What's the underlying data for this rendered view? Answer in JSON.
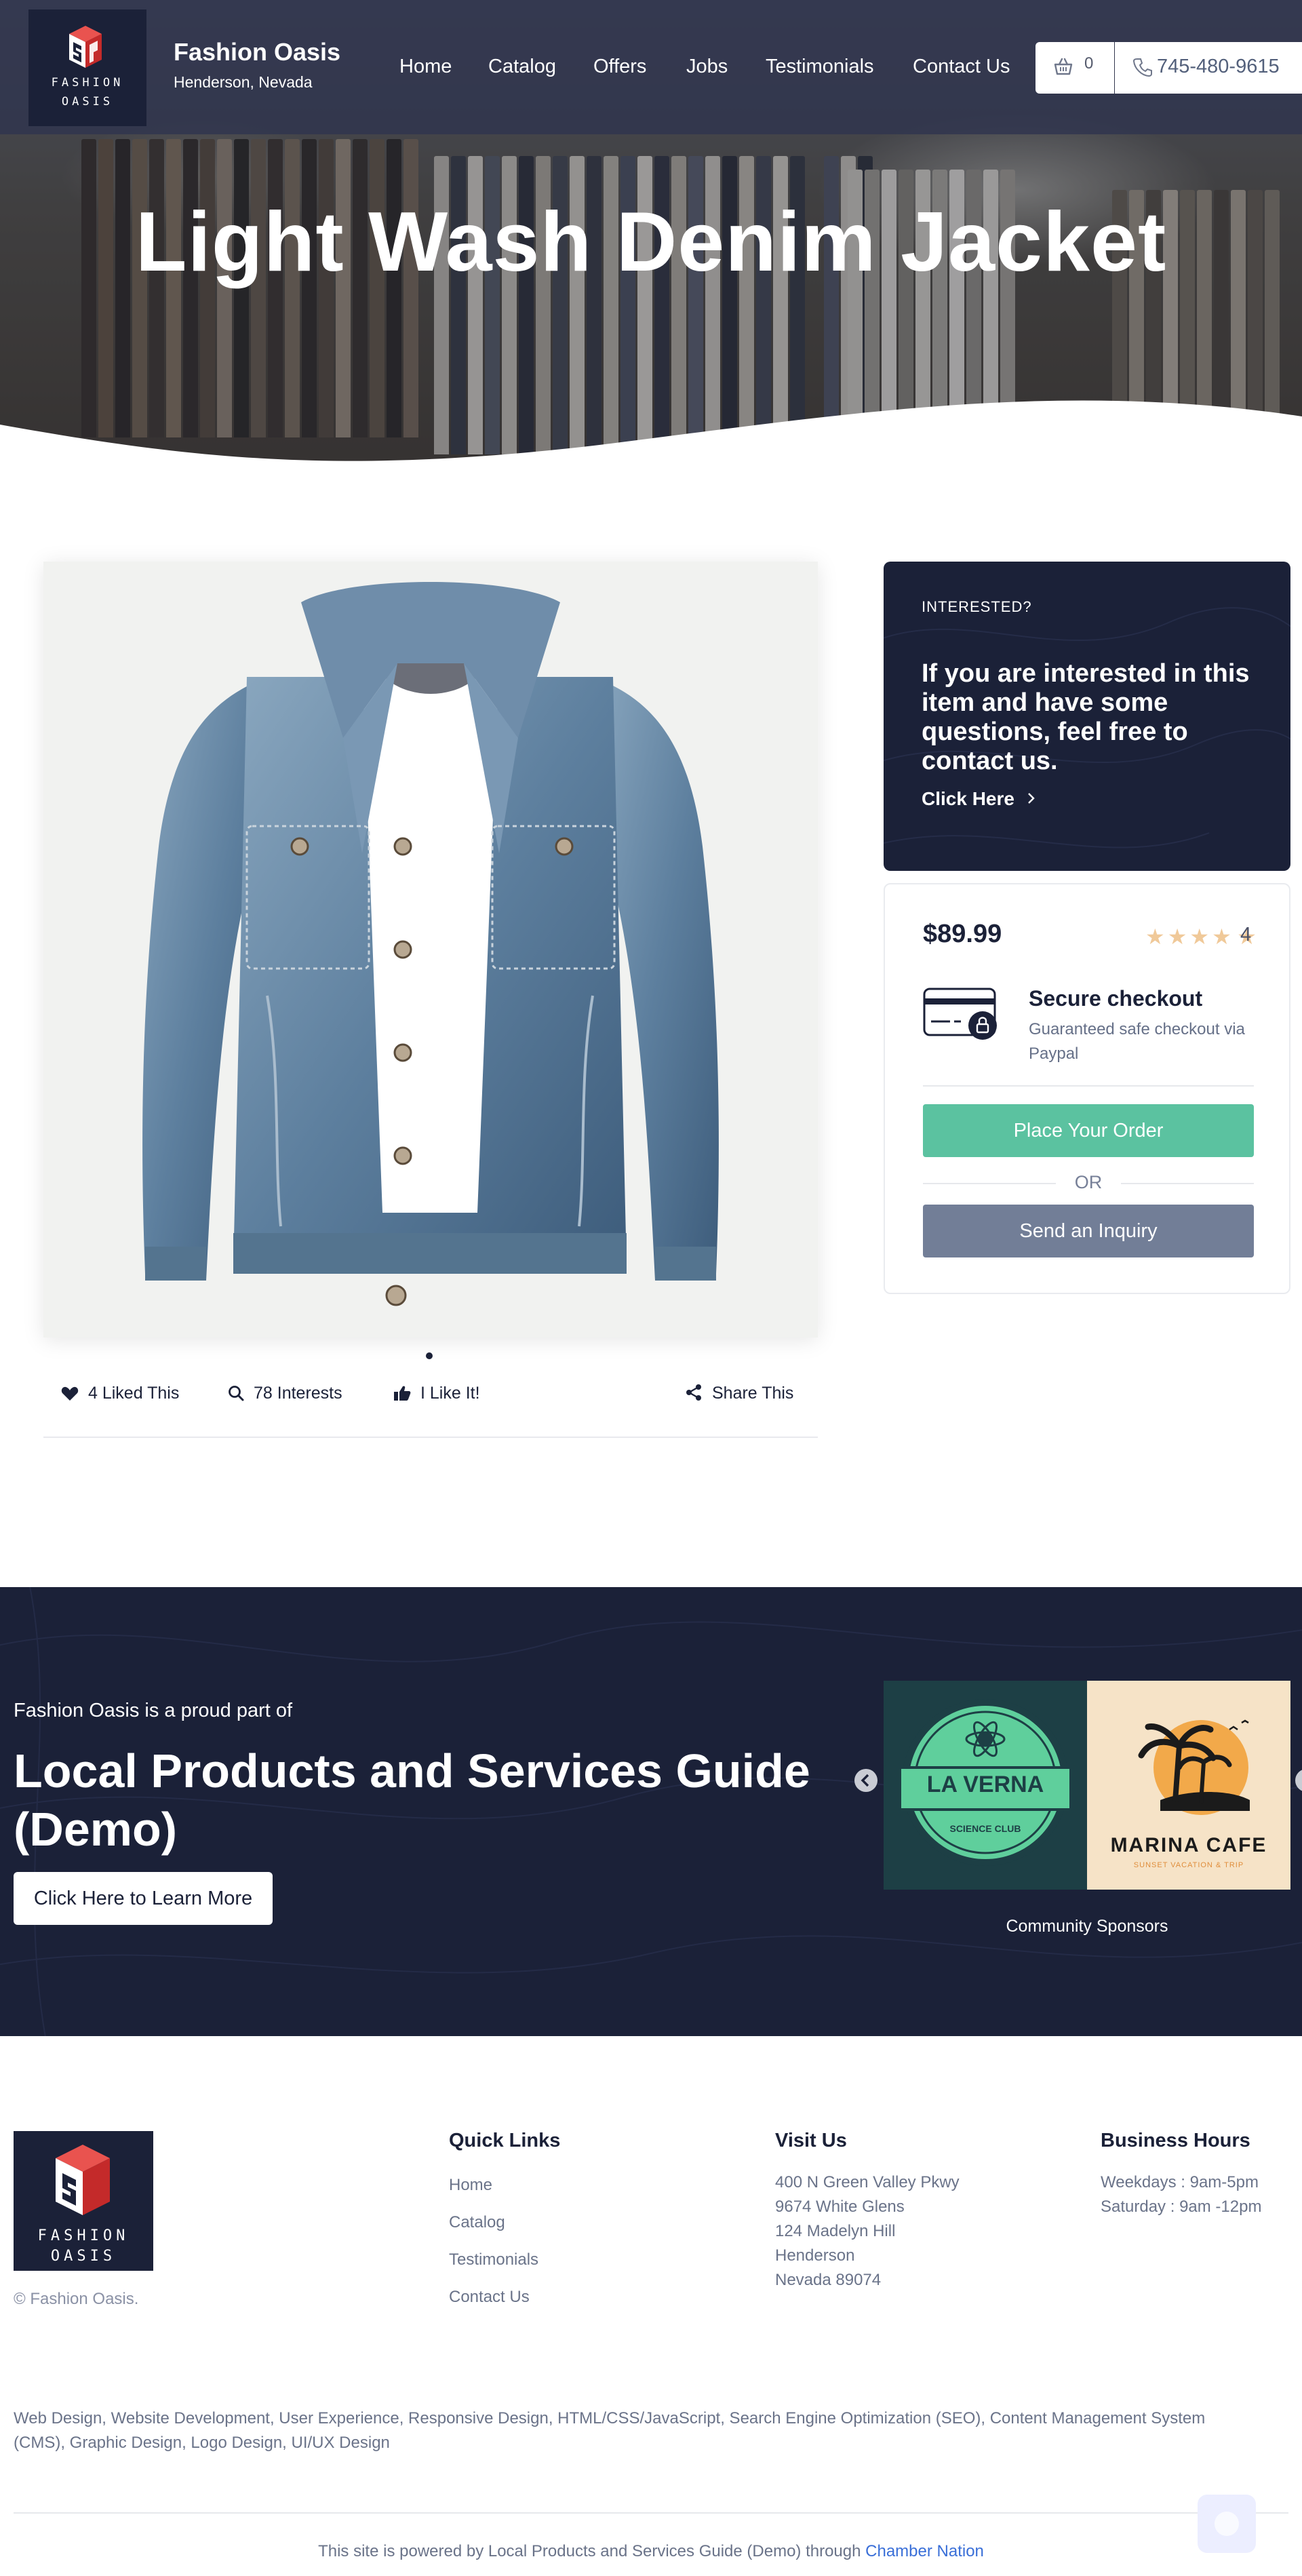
{
  "brand": {
    "logo_line1": "FASHION",
    "logo_line2": "OASIS",
    "name": "Fashion Oasis",
    "location": "Henderson, Nevada",
    "logo_colors": {
      "block": "#1b2138",
      "red": "#d8302f",
      "white": "#ffffff"
    }
  },
  "nav": {
    "items": [
      "Home",
      "Catalog",
      "Offers",
      "Jobs",
      "Testimonials",
      "Contact Us"
    ],
    "cart_count": "0",
    "phone": "745-480-9615"
  },
  "hero": {
    "title": "Light Wash Denim Jacket"
  },
  "product": {
    "image_alt": "Light wash denim jacket",
    "actions": {
      "liked": "4 Liked This",
      "interests": "78 Interests",
      "like": "I Like It!",
      "share": "Share This"
    }
  },
  "interest": {
    "kicker": "INTERESTED?",
    "text": "If you are interested in this item and have some questions, feel free to contact us.",
    "link": "Click Here"
  },
  "purchase": {
    "price": "$89.99",
    "stars": 5,
    "rating": "4",
    "checkout_title": "Secure checkout",
    "checkout_sub": "Guaranteed safe checkout via Paypal",
    "order_button": "Place Your Order",
    "or": "OR",
    "inquiry_button": "Send an Inquiry"
  },
  "guide": {
    "kicker": "Fashion Oasis is a proud part of",
    "title": "Local Products and Services Guide (Demo)",
    "button": "Click Here to Learn More",
    "sponsors_label": "Community Sponsors",
    "sponsor1": {
      "line1": "LA VERNA",
      "line2": "SCIENCE CLUB"
    },
    "sponsor2": {
      "line1": "MARINA CAFE",
      "line2": "SUNSET VACATION & TRIP"
    }
  },
  "footer": {
    "copyright": "© Fashion Oasis.",
    "quick_links_title": "Quick Links",
    "quick_links": [
      "Home",
      "Catalog",
      "Testimonials",
      "Contact Us"
    ],
    "visit_title": "Visit Us",
    "address": [
      "400 N Green Valley Pkwy",
      "9674 White Glens",
      "124 Madelyn Hill",
      "Henderson",
      "Nevada 89074"
    ],
    "hours_title": "Business Hours",
    "hours": [
      "Weekdays : 9am-5pm",
      "Saturday : 9am -12pm"
    ],
    "tags": "Web Design, Website Development, User Experience, Responsive Design, HTML/CSS/JavaScript, Search Engine Optimization (SEO), Content Management System (CMS), Graphic Design, Logo Design, UI/UX Design",
    "powered_prefix": "This site is powered by Local Products and Services Guide (Demo) through",
    "powered_link": "Chamber Nation"
  },
  "colors": {
    "navy": "#1b2138",
    "green_button": "#5bc2a0",
    "slate_button": "#727e97",
    "star": "#f0c999",
    "link_blue": "#3a6fd8"
  }
}
